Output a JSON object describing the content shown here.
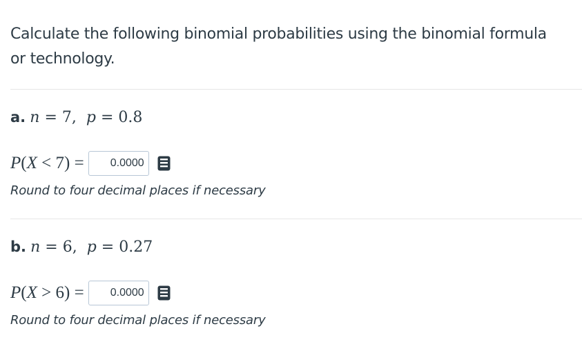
{
  "question": {
    "text": "Calculate the following binomial probabilities using the binomial formula or technology."
  },
  "parts": [
    {
      "letter": "a.",
      "n_var": "n",
      "n_value": "7",
      "p_var": "p",
      "p_value": "0.8",
      "prob_prefix": "P",
      "prob_var": "X",
      "prob_op": "<",
      "prob_value": "7",
      "answer_value": "0.0000",
      "hint": "Round to four decimal places if necessary",
      "calculator_icon": "calculator-icon"
    },
    {
      "letter": "b.",
      "n_var": "n",
      "n_value": "6",
      "p_var": "p",
      "p_value": "0.27",
      "prob_prefix": "P",
      "prob_var": "X",
      "prob_op": ">",
      "prob_value": "6",
      "answer_value": "0.0000",
      "hint": "Round to four decimal places if necessary",
      "calculator_icon": "calculator-icon"
    }
  ],
  "colors": {
    "text": "#2d3b45",
    "divider": "#e6e6e6",
    "input_border": "#b7c6d6",
    "icon": "#2d3b45"
  }
}
